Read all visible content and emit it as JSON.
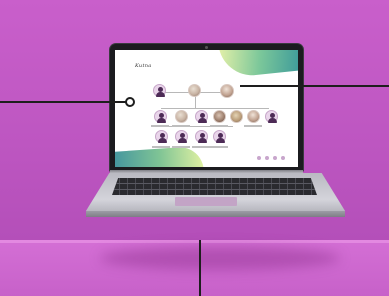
{
  "screen": {
    "site_title": "Kutna"
  },
  "colors": {
    "background": "#c25cc6",
    "floor": "#d46fd5",
    "callout": "#1e1e1e",
    "accent_green": "#7bc79a",
    "accent_teal": "#2d8f9a"
  },
  "icons": {
    "callout_marker": "circle-marker-icon",
    "person": "person-silhouette-icon"
  }
}
